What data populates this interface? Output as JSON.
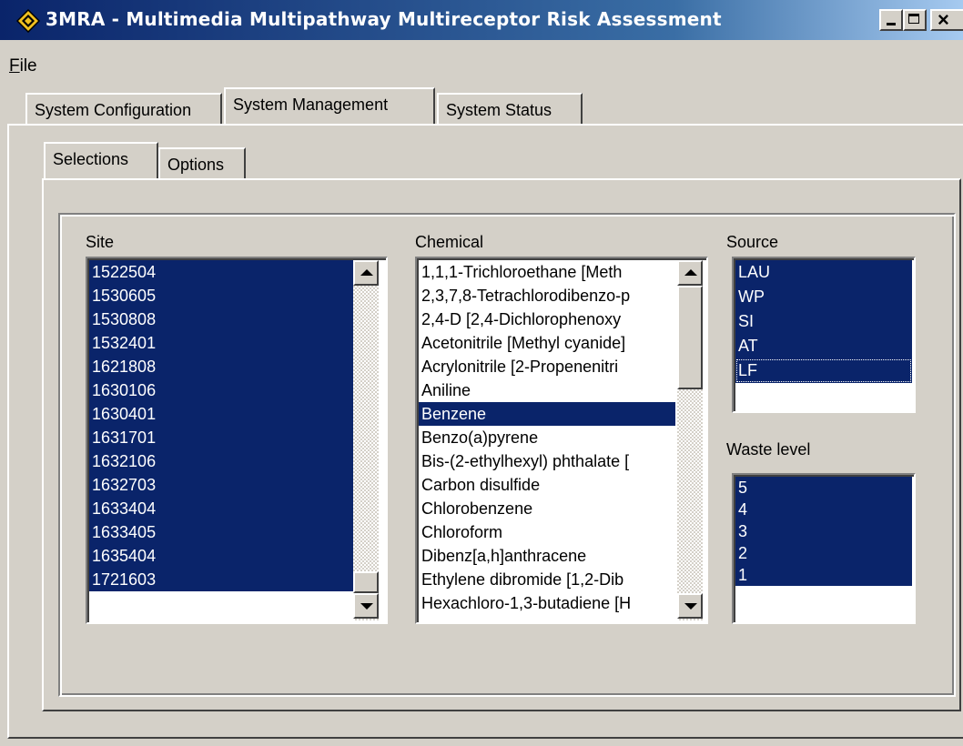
{
  "window": {
    "title": "3MRA - Multimedia Multipathway Multireceptor Risk Assessment",
    "icon": "diamond-app-icon"
  },
  "menu": {
    "file_accel": "F",
    "file_rest": "ile"
  },
  "tabs": [
    {
      "label": "System Configuration",
      "active": false
    },
    {
      "label": "System Management",
      "active": true
    },
    {
      "label": "System Status",
      "active": false
    }
  ],
  "subtabs": [
    {
      "label": "Selections",
      "active": true
    },
    {
      "label": "Options",
      "active": false
    }
  ],
  "site": {
    "label": "Site",
    "items": [
      "1522504",
      "1530605",
      "1530808",
      "1532401",
      "1621808",
      "1630106",
      "1630401",
      "1631701",
      "1632106",
      "1632703",
      "1633404",
      "1633405",
      "1635404",
      "1721603"
    ],
    "selected": "all"
  },
  "chemical": {
    "label": "Chemical",
    "items": [
      "1,1,1-Trichloroethane  [Meth",
      "2,3,7,8-Tetrachlorodibenzo-p",
      "2,4-D  [2,4-Dichlorophenoxy",
      "Acetonitrile  [Methyl cyanide]",
      "Acrylonitrile  [2-Propenenitri",
      "Aniline",
      "Benzene",
      "Benzo(a)pyrene",
      "Bis-(2-ethylhexyl) phthalate  [",
      "Carbon disulfide",
      "Chlorobenzene",
      "Chloroform",
      "Dibenz[a,h]anthracene",
      "Ethylene dibromide  [1,2-Dib",
      "Hexachloro-1,3-butadiene  [H"
    ],
    "selected": "Benzene"
  },
  "source": {
    "label": "Source",
    "items": [
      "LAU",
      "WP",
      "SI",
      "AT",
      "LF"
    ],
    "selected": "all",
    "focused": "LF"
  },
  "waste_level": {
    "label": "Waste level",
    "items": [
      "5",
      "4",
      "3",
      "2",
      "1"
    ],
    "selected": "all"
  },
  "colors": {
    "selection": "#0a246a",
    "face": "#d4d0c8",
    "title_start": "#0a246a"
  }
}
